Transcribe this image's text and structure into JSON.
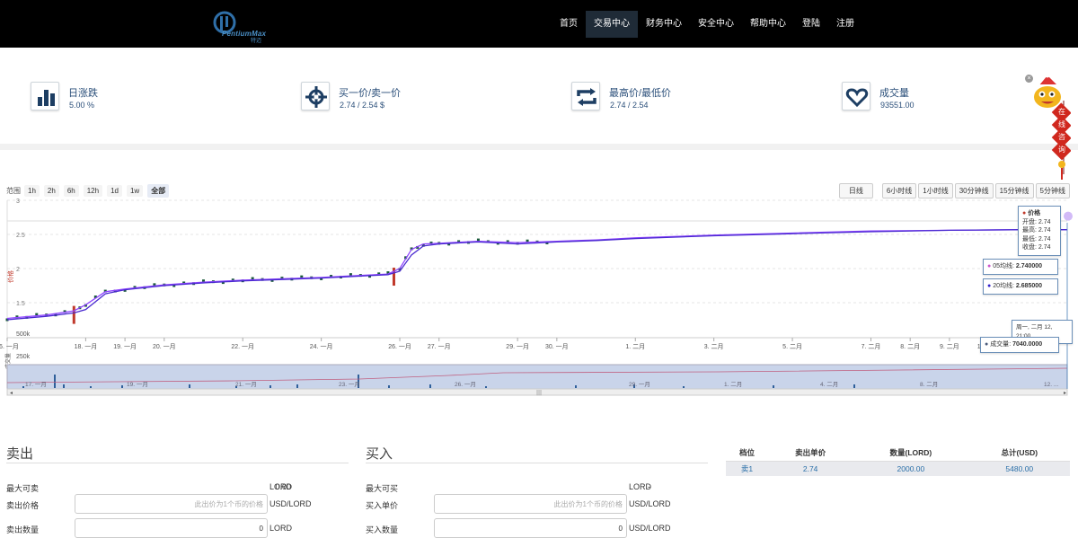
{
  "header": {
    "brand": "PentiumMax",
    "brand_sub": "特迈",
    "nav": [
      {
        "label": "首页",
        "active": false
      },
      {
        "label": "交易中心",
        "active": true
      },
      {
        "label": "财务中心",
        "active": false
      },
      {
        "label": "安全中心",
        "active": false
      },
      {
        "label": "帮助中心",
        "active": false
      },
      {
        "label": "登陆",
        "active": false
      },
      {
        "label": "注册",
        "active": false
      }
    ]
  },
  "stats": [
    {
      "icon": "bar-chart-icon",
      "label": "日涨跌",
      "value": "5.00 %"
    },
    {
      "icon": "crosshair-icon",
      "label": "买一价/卖一价",
      "value": "2.74 / 2.54 $"
    },
    {
      "icon": "refresh-arrows-icon",
      "label": "最高价/最低价",
      "value": "2.74 / 2.54"
    },
    {
      "icon": "heart-icon",
      "label": "成交量",
      "value": "93551.00"
    }
  ],
  "chat": {
    "label": "在线咨询",
    "close": "×"
  },
  "chart": {
    "range_label": "范围",
    "ranges": [
      {
        "label": "1h",
        "active": false
      },
      {
        "label": "2h",
        "active": false
      },
      {
        "label": "6h",
        "active": false
      },
      {
        "label": "12h",
        "active": false
      },
      {
        "label": "1d",
        "active": false
      },
      {
        "label": "1w",
        "active": false
      },
      {
        "label": "全部",
        "active": true
      }
    ],
    "periods": [
      "日线",
      "6小时线",
      "1小时线",
      "30分钟线",
      "15分钟线",
      "5分钟线"
    ],
    "y_ticks": [
      "3",
      "2.5",
      "2",
      "1.5"
    ],
    "y_label": "价格",
    "vol_label": "成交量",
    "vol_ticks": [
      "500k",
      "250k"
    ],
    "x_ticks": [
      "16. 一月",
      "18. 一月",
      "19. 一月",
      "20. 一月",
      "22. 一月",
      "24. 一月",
      "26. 一月",
      "27. 一月",
      "29. 一月",
      "30. 一月",
      "1. 二月",
      "3. 二月",
      "5. 二月",
      "7. 二月",
      "8. 二月",
      "9. 二月",
      "10. 二月"
    ],
    "nav_ticks": [
      "17. 一月",
      "19. 一月",
      "21. 一月",
      "23. 一月",
      "26. 一月",
      "29. 一月",
      "1. 二月",
      "4. 二月",
      "8. 二月",
      "12. ..."
    ],
    "price_tooltip": {
      "title": "价格",
      "open_label": "开盘",
      "open": "2.74",
      "high_label": "最高",
      "high": "2.74",
      "low_label": "最低",
      "low": "2.74",
      "close_label": "收盘",
      "close": "2.74"
    },
    "ma5": {
      "label": "05均线",
      "value": "2.740000",
      "color": "#cc55cc"
    },
    "ma20": {
      "label": "20均线",
      "value": "2.685000",
      "color": "#3322cc"
    },
    "time_tooltip": "周一, 二月 12, 21:00",
    "volume_tooltip": {
      "label": "成交量",
      "value": "7040.0000"
    },
    "colors": {
      "up": "#1a5a3a",
      "down": "#c0392b",
      "ma5": "#8e44ff",
      "ma20": "#4a2ad0",
      "nav_fill": "#c9d4ea"
    }
  },
  "chart_data": {
    "type": "line",
    "title": "",
    "ylabel": "价格",
    "ylim": [
      1.0,
      3.0
    ],
    "series": [
      {
        "name": "05均线",
        "x": [
          16,
          17,
          17.7,
          18,
          18.5,
          19,
          20,
          21,
          22,
          23,
          24,
          25,
          25.7,
          26,
          26.3,
          26.6,
          27,
          28,
          29,
          30,
          31,
          32,
          34,
          36,
          38,
          40,
          42,
          43
        ],
        "values": [
          1.27,
          1.32,
          1.38,
          1.47,
          1.66,
          1.7,
          1.76,
          1.8,
          1.83,
          1.85,
          1.87,
          1.9,
          1.92,
          2.0,
          2.28,
          2.36,
          2.37,
          2.4,
          2.38,
          2.4,
          2.42,
          2.45,
          2.49,
          2.52,
          2.55,
          2.56,
          2.57,
          2.57
        ]
      },
      {
        "name": "20均线",
        "x": [
          16,
          17,
          17.7,
          18,
          18.5,
          19,
          20,
          21,
          22,
          23,
          24,
          25,
          25.7,
          26,
          26.3,
          26.6,
          27,
          28,
          29,
          30,
          31,
          32,
          34,
          36,
          38,
          40,
          42,
          43
        ],
        "values": [
          1.25,
          1.3,
          1.35,
          1.4,
          1.63,
          1.69,
          1.75,
          1.79,
          1.82,
          1.84,
          1.86,
          1.89,
          1.91,
          1.96,
          2.2,
          2.33,
          2.36,
          2.39,
          2.36,
          2.39,
          2.41,
          2.44,
          2.48,
          2.51,
          2.54,
          2.56,
          2.57,
          2.57
        ]
      }
    ],
    "volume_ylim": [
      0,
      500000
    ]
  },
  "sell": {
    "title": "卖出",
    "max_label": "最大可卖",
    "max_value": "0.00",
    "max_unit": "LORD",
    "price_label": "卖出价格",
    "price_placeholder": "此出价为1个币的价格",
    "price_unit": "USD/LORD",
    "qty_label": "卖出数量",
    "qty_value": "0",
    "qty_unit": "LORD"
  },
  "buy": {
    "title": "买入",
    "max_label": "最大可买",
    "max_value": "-",
    "max_unit": "LORD",
    "price_label": "买入单价",
    "price_placeholder": "此出价为1个币的价格",
    "price_unit": "USD/LORD",
    "qty_label": "买入数量",
    "qty_value": "0",
    "qty_unit": "USD/LORD"
  },
  "orders": {
    "columns": [
      "档位",
      "卖出单价",
      "数量(LORD)",
      "总计(USD)"
    ],
    "rows": [
      {
        "level": "卖1",
        "price": "2.74",
        "qty": "2000.00",
        "total": "5480.00"
      }
    ]
  }
}
